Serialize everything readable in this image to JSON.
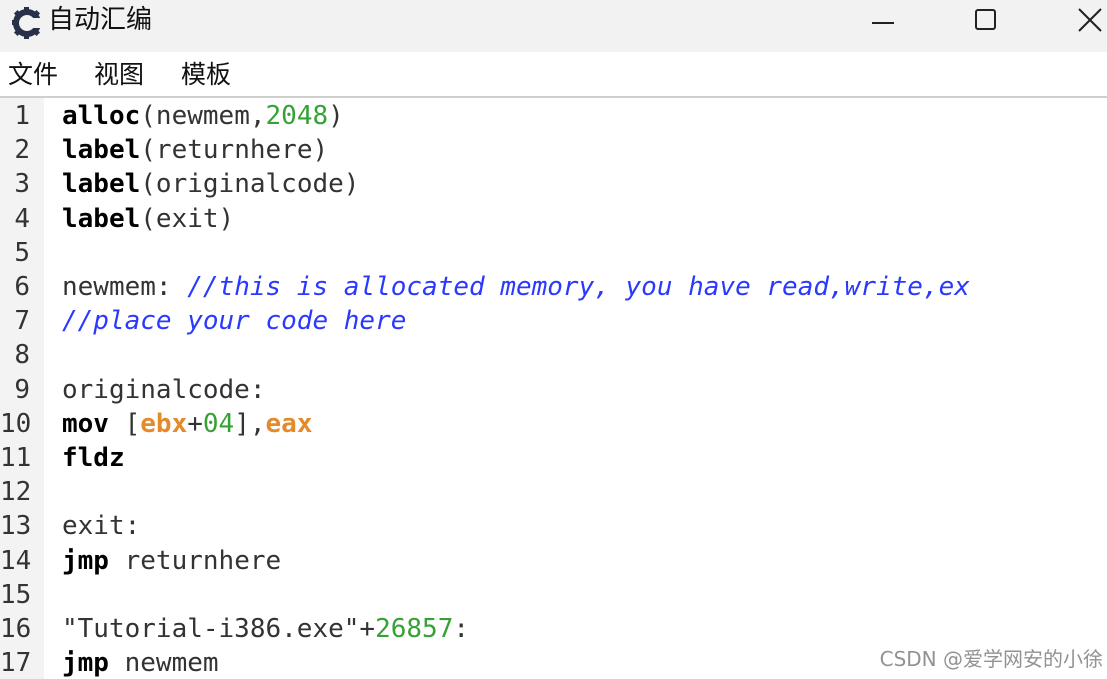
{
  "window": {
    "title": "自动汇编",
    "icon": "cheat-engine-gear-icon",
    "controls": [
      "minimize-icon",
      "maximize-icon",
      "close-icon"
    ]
  },
  "menu": {
    "file": "文件",
    "view": "视图",
    "template": "模板"
  },
  "editor": {
    "lines": [
      {
        "num": "1",
        "tokens": [
          {
            "t": "alloc",
            "c": "kw"
          },
          {
            "t": "(newmem,",
            "c": "plain"
          },
          {
            "t": "2048",
            "c": "num"
          },
          {
            "t": ")",
            "c": "plain"
          }
        ]
      },
      {
        "num": "2",
        "tokens": [
          {
            "t": "label",
            "c": "kw"
          },
          {
            "t": "(returnhere)",
            "c": "plain"
          }
        ]
      },
      {
        "num": "3",
        "tokens": [
          {
            "t": "label",
            "c": "kw"
          },
          {
            "t": "(originalcode)",
            "c": "plain"
          }
        ]
      },
      {
        "num": "4",
        "tokens": [
          {
            "t": "label",
            "c": "kw"
          },
          {
            "t": "(exit)",
            "c": "plain"
          }
        ]
      },
      {
        "num": "5",
        "tokens": []
      },
      {
        "num": "6",
        "tokens": [
          {
            "t": "newmem: ",
            "c": "plain"
          },
          {
            "t": "//this is allocated memory, you have read,write,ex",
            "c": "comment"
          }
        ]
      },
      {
        "num": "7",
        "tokens": [
          {
            "t": "//place your code here",
            "c": "comment"
          }
        ]
      },
      {
        "num": "8",
        "tokens": []
      },
      {
        "num": "9",
        "tokens": [
          {
            "t": "originalcode:",
            "c": "plain"
          }
        ]
      },
      {
        "num": "10",
        "tokens": [
          {
            "t": "mov",
            "c": "kw"
          },
          {
            "t": " [",
            "c": "plain"
          },
          {
            "t": "ebx",
            "c": "reg"
          },
          {
            "t": "+",
            "c": "plain"
          },
          {
            "t": "04",
            "c": "num"
          },
          {
            "t": "],",
            "c": "plain"
          },
          {
            "t": "eax",
            "c": "reg"
          }
        ]
      },
      {
        "num": "11",
        "tokens": [
          {
            "t": "fldz",
            "c": "kw"
          }
        ]
      },
      {
        "num": "12",
        "tokens": []
      },
      {
        "num": "13",
        "tokens": [
          {
            "t": "exit:",
            "c": "plain"
          }
        ]
      },
      {
        "num": "14",
        "tokens": [
          {
            "t": "jmp",
            "c": "kw"
          },
          {
            "t": " returnhere",
            "c": "plain"
          }
        ]
      },
      {
        "num": "15",
        "tokens": []
      },
      {
        "num": "16",
        "tokens": [
          {
            "t": "\"Tutorial-i386.exe\"+",
            "c": "plain"
          },
          {
            "t": "26857",
            "c": "num"
          },
          {
            "t": ":",
            "c": "plain"
          }
        ]
      },
      {
        "num": "17",
        "tokens": [
          {
            "t": "jmp",
            "c": "kw"
          },
          {
            "t": " newmem",
            "c": "plain"
          }
        ]
      }
    ]
  },
  "watermark": "CSDN @爱学网安的小徐",
  "colors": {
    "keyword": "#000000",
    "number": "#36a236",
    "register": "#e58a2a",
    "comment": "#2b39ff",
    "plain": "#333333"
  }
}
